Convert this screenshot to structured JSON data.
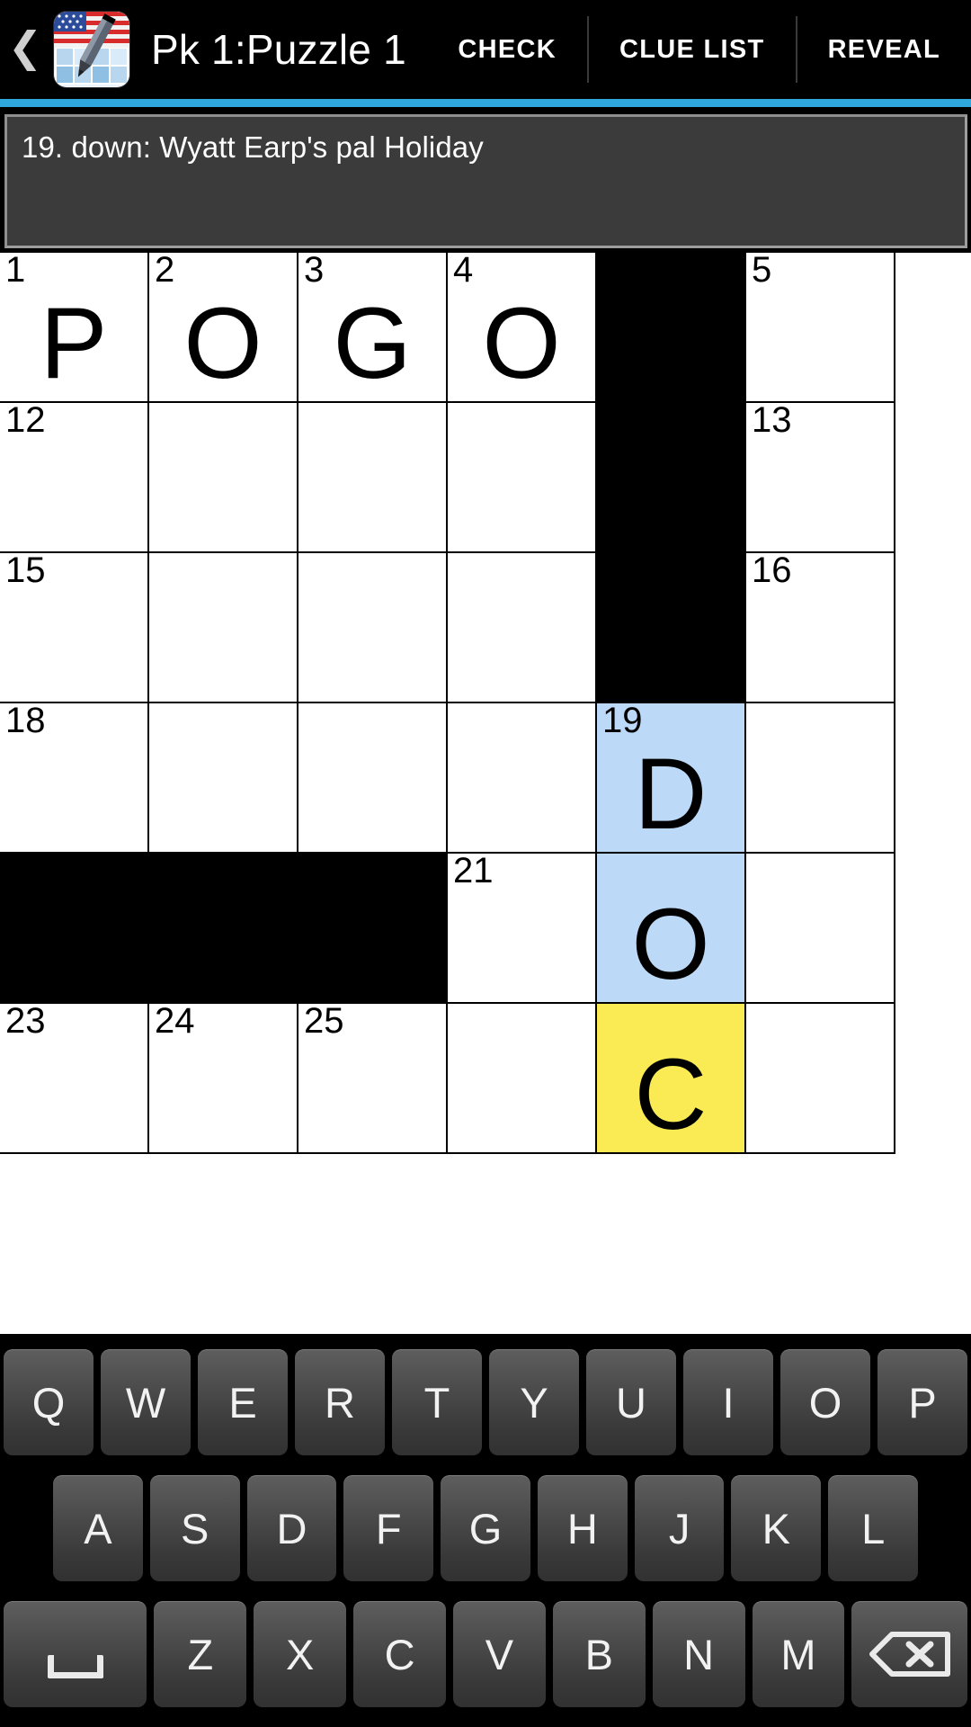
{
  "appbar": {
    "back_icon": "chevron-left-icon",
    "app_icon": "usa-crossword-pencil-icon",
    "title": "Pk 1:Puzzle 1",
    "actions": [
      {
        "label": "CHECK",
        "name": "check-button"
      },
      {
        "label": "CLUE LIST",
        "name": "clue-list-button"
      },
      {
        "label": "REVEAL",
        "name": "reveal-button"
      }
    ],
    "accent_color": "#2fa8dd"
  },
  "clue": {
    "text": "19. down: Wyatt Earp's pal Holiday"
  },
  "grid": {
    "colors": {
      "empty": "#ffffff",
      "block": "#000000",
      "word_highlight": "#bcd9f7",
      "cursor_highlight": "#faeb54"
    },
    "rows": [
      [
        {
          "num": "1",
          "letter": "P",
          "state": "normal"
        },
        {
          "num": "2",
          "letter": "O",
          "state": "normal"
        },
        {
          "num": "3",
          "letter": "G",
          "state": "normal"
        },
        {
          "num": "4",
          "letter": "O",
          "state": "normal"
        },
        {
          "num": "",
          "letter": "",
          "state": "block"
        },
        {
          "num": "5",
          "letter": "",
          "state": "normal"
        }
      ],
      [
        {
          "num": "12",
          "letter": "",
          "state": "normal"
        },
        {
          "num": "",
          "letter": "",
          "state": "normal"
        },
        {
          "num": "",
          "letter": "",
          "state": "normal"
        },
        {
          "num": "",
          "letter": "",
          "state": "normal"
        },
        {
          "num": "",
          "letter": "",
          "state": "block"
        },
        {
          "num": "13",
          "letter": "",
          "state": "normal"
        }
      ],
      [
        {
          "num": "15",
          "letter": "",
          "state": "normal"
        },
        {
          "num": "",
          "letter": "",
          "state": "normal"
        },
        {
          "num": "",
          "letter": "",
          "state": "normal"
        },
        {
          "num": "",
          "letter": "",
          "state": "normal"
        },
        {
          "num": "",
          "letter": "",
          "state": "block"
        },
        {
          "num": "16",
          "letter": "",
          "state": "normal"
        }
      ],
      [
        {
          "num": "18",
          "letter": "",
          "state": "normal"
        },
        {
          "num": "",
          "letter": "",
          "state": "normal"
        },
        {
          "num": "",
          "letter": "",
          "state": "normal"
        },
        {
          "num": "",
          "letter": "",
          "state": "normal"
        },
        {
          "num": "19",
          "letter": "D",
          "state": "word"
        },
        {
          "num": "",
          "letter": "",
          "state": "normal"
        }
      ],
      [
        {
          "num": "",
          "letter": "",
          "state": "block"
        },
        {
          "num": "",
          "letter": "",
          "state": "block"
        },
        {
          "num": "",
          "letter": "",
          "state": "block"
        },
        {
          "num": "21",
          "letter": "",
          "state": "normal"
        },
        {
          "num": "",
          "letter": "O",
          "state": "word"
        },
        {
          "num": "",
          "letter": "",
          "state": "normal"
        }
      ],
      [
        {
          "num": "23",
          "letter": "",
          "state": "normal"
        },
        {
          "num": "24",
          "letter": "",
          "state": "normal"
        },
        {
          "num": "25",
          "letter": "",
          "state": "normal"
        },
        {
          "num": "",
          "letter": "",
          "state": "normal"
        },
        {
          "num": "",
          "letter": "C",
          "state": "cursor"
        },
        {
          "num": "",
          "letter": "",
          "state": "normal"
        }
      ]
    ]
  },
  "keyboard": {
    "row1": [
      "Q",
      "W",
      "E",
      "R",
      "T",
      "Y",
      "U",
      "I",
      "O",
      "P"
    ],
    "row2": [
      "A",
      "S",
      "D",
      "F",
      "G",
      "H",
      "J",
      "K",
      "L"
    ],
    "row3": [
      "Z",
      "X",
      "C",
      "V",
      "B",
      "N",
      "M"
    ],
    "space_key": {
      "name": "space-key",
      "icon": "space-bar-icon"
    },
    "backspace_key": {
      "name": "backspace-key",
      "icon": "backspace-icon"
    }
  }
}
